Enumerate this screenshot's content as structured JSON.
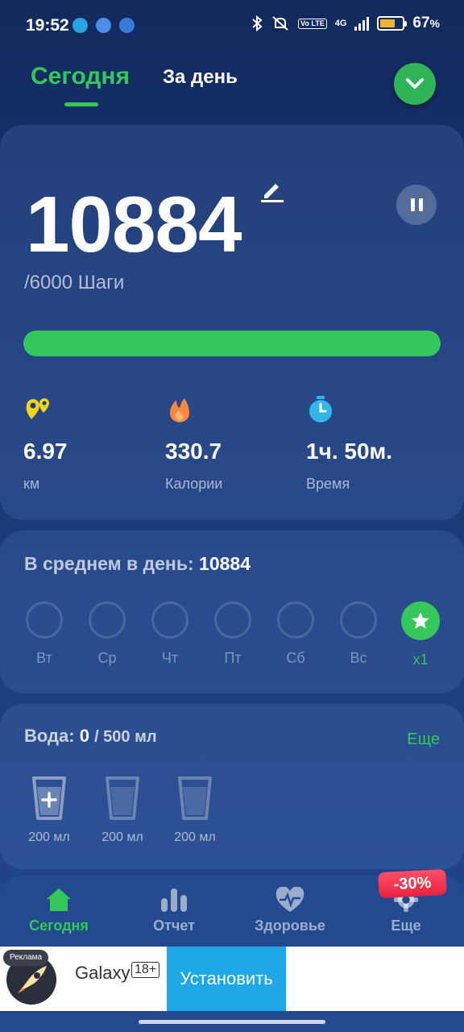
{
  "status_bar": {
    "time": "19:52",
    "battery_percent_label": "67",
    "battery_percent_symbol": "%",
    "battery_level": 0.67,
    "network": "4G",
    "volte": "Vo LTE",
    "icons": [
      "telegram-icon",
      "app-icon",
      "app-icon",
      "bluetooth-icon",
      "mute-icon",
      "signal-icon",
      "battery-icon"
    ]
  },
  "header": {
    "tabs": [
      {
        "label": "Сегодня",
        "active": true
      },
      {
        "label": "За день",
        "active": false
      }
    ]
  },
  "steps": {
    "value": "10884",
    "goal_label": "/6000 Шаги",
    "progress": 1.0
  },
  "stats": [
    {
      "icon": "location-pin-icon",
      "value": "6.97",
      "unit": "км",
      "color": "#f1d51a"
    },
    {
      "icon": "flame-icon",
      "value": "330.7",
      "unit": "Калории",
      "color": "#ff8a3d"
    },
    {
      "icon": "stopwatch-icon",
      "value": "1ч. 50м.",
      "unit": "Время",
      "color": "#33b5ea"
    }
  ],
  "average": {
    "label": "В среднем в день:",
    "value": "10884",
    "days": [
      {
        "label": "Вт",
        "done": false
      },
      {
        "label": "Ср",
        "done": false
      },
      {
        "label": "Чт",
        "done": false
      },
      {
        "label": "Пт",
        "done": false
      },
      {
        "label": "Сб",
        "done": false
      },
      {
        "label": "Вс",
        "done": false
      },
      {
        "label": "x1",
        "done": true
      }
    ]
  },
  "water": {
    "label": "Вода:",
    "value": "0",
    "goal": "/ 500 мл",
    "more": "Еще",
    "cups": [
      "200 мл",
      "200 мл",
      "200 мл"
    ]
  },
  "nav": {
    "items": [
      {
        "label": "Сегодня",
        "icon": "home-icon",
        "active": true
      },
      {
        "label": "Отчет",
        "icon": "chart-bars-icon",
        "active": false
      },
      {
        "label": "Здоровье",
        "icon": "heart-pulse-icon",
        "active": false
      },
      {
        "label": "Еще",
        "icon": "gear-icon",
        "active": false
      }
    ],
    "sale_badge": "-30%"
  },
  "ad": {
    "tag": "Реклама",
    "name": "Galaxy",
    "age": "18+",
    "install": "Установить"
  },
  "colors": {
    "accent": "#34c759",
    "background": "#1b3b7a",
    "sale": "#e8233f",
    "install": "#1fa7e8"
  }
}
